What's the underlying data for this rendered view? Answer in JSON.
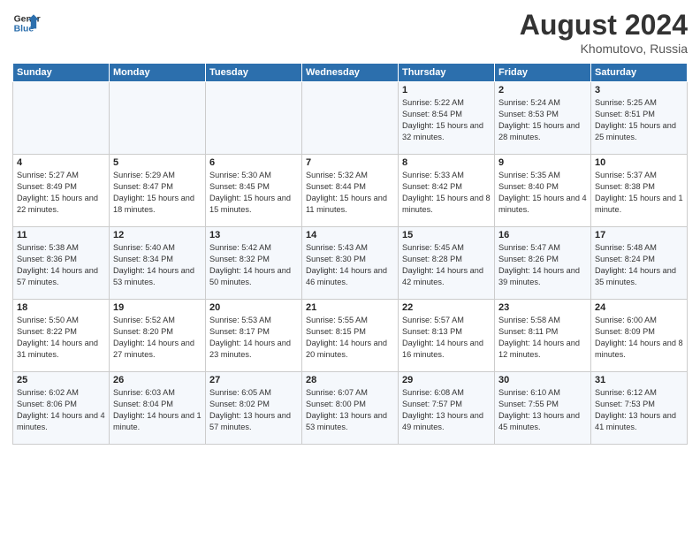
{
  "header": {
    "logo_line1": "General",
    "logo_line2": "Blue",
    "month_title": "August 2024",
    "location": "Khomutovo, Russia"
  },
  "weekdays": [
    "Sunday",
    "Monday",
    "Tuesday",
    "Wednesday",
    "Thursday",
    "Friday",
    "Saturday"
  ],
  "weeks": [
    [
      {
        "day": "",
        "empty": true
      },
      {
        "day": "",
        "empty": true
      },
      {
        "day": "",
        "empty": true
      },
      {
        "day": "",
        "empty": true
      },
      {
        "day": "1",
        "sunrise": "5:22 AM",
        "sunset": "8:54 PM",
        "daylight": "15 hours and 32 minutes."
      },
      {
        "day": "2",
        "sunrise": "5:24 AM",
        "sunset": "8:53 PM",
        "daylight": "15 hours and 28 minutes."
      },
      {
        "day": "3",
        "sunrise": "5:25 AM",
        "sunset": "8:51 PM",
        "daylight": "15 hours and 25 minutes."
      }
    ],
    [
      {
        "day": "4",
        "sunrise": "5:27 AM",
        "sunset": "8:49 PM",
        "daylight": "15 hours and 22 minutes."
      },
      {
        "day": "5",
        "sunrise": "5:29 AM",
        "sunset": "8:47 PM",
        "daylight": "15 hours and 18 minutes."
      },
      {
        "day": "6",
        "sunrise": "5:30 AM",
        "sunset": "8:45 PM",
        "daylight": "15 hours and 15 minutes."
      },
      {
        "day": "7",
        "sunrise": "5:32 AM",
        "sunset": "8:44 PM",
        "daylight": "15 hours and 11 minutes."
      },
      {
        "day": "8",
        "sunrise": "5:33 AM",
        "sunset": "8:42 PM",
        "daylight": "15 hours and 8 minutes."
      },
      {
        "day": "9",
        "sunrise": "5:35 AM",
        "sunset": "8:40 PM",
        "daylight": "15 hours and 4 minutes."
      },
      {
        "day": "10",
        "sunrise": "5:37 AM",
        "sunset": "8:38 PM",
        "daylight": "15 hours and 1 minute."
      }
    ],
    [
      {
        "day": "11",
        "sunrise": "5:38 AM",
        "sunset": "8:36 PM",
        "daylight": "14 hours and 57 minutes."
      },
      {
        "day": "12",
        "sunrise": "5:40 AM",
        "sunset": "8:34 PM",
        "daylight": "14 hours and 53 minutes."
      },
      {
        "day": "13",
        "sunrise": "5:42 AM",
        "sunset": "8:32 PM",
        "daylight": "14 hours and 50 minutes."
      },
      {
        "day": "14",
        "sunrise": "5:43 AM",
        "sunset": "8:30 PM",
        "daylight": "14 hours and 46 minutes."
      },
      {
        "day": "15",
        "sunrise": "5:45 AM",
        "sunset": "8:28 PM",
        "daylight": "14 hours and 42 minutes."
      },
      {
        "day": "16",
        "sunrise": "5:47 AM",
        "sunset": "8:26 PM",
        "daylight": "14 hours and 39 minutes."
      },
      {
        "day": "17",
        "sunrise": "5:48 AM",
        "sunset": "8:24 PM",
        "daylight": "14 hours and 35 minutes."
      }
    ],
    [
      {
        "day": "18",
        "sunrise": "5:50 AM",
        "sunset": "8:22 PM",
        "daylight": "14 hours and 31 minutes."
      },
      {
        "day": "19",
        "sunrise": "5:52 AM",
        "sunset": "8:20 PM",
        "daylight": "14 hours and 27 minutes."
      },
      {
        "day": "20",
        "sunrise": "5:53 AM",
        "sunset": "8:17 PM",
        "daylight": "14 hours and 23 minutes."
      },
      {
        "day": "21",
        "sunrise": "5:55 AM",
        "sunset": "8:15 PM",
        "daylight": "14 hours and 20 minutes."
      },
      {
        "day": "22",
        "sunrise": "5:57 AM",
        "sunset": "8:13 PM",
        "daylight": "14 hours and 16 minutes."
      },
      {
        "day": "23",
        "sunrise": "5:58 AM",
        "sunset": "8:11 PM",
        "daylight": "14 hours and 12 minutes."
      },
      {
        "day": "24",
        "sunrise": "6:00 AM",
        "sunset": "8:09 PM",
        "daylight": "14 hours and 8 minutes."
      }
    ],
    [
      {
        "day": "25",
        "sunrise": "6:02 AM",
        "sunset": "8:06 PM",
        "daylight": "14 hours and 4 minutes."
      },
      {
        "day": "26",
        "sunrise": "6:03 AM",
        "sunset": "8:04 PM",
        "daylight": "14 hours and 1 minute."
      },
      {
        "day": "27",
        "sunrise": "6:05 AM",
        "sunset": "8:02 PM",
        "daylight": "13 hours and 57 minutes."
      },
      {
        "day": "28",
        "sunrise": "6:07 AM",
        "sunset": "8:00 PM",
        "daylight": "13 hours and 53 minutes."
      },
      {
        "day": "29",
        "sunrise": "6:08 AM",
        "sunset": "7:57 PM",
        "daylight": "13 hours and 49 minutes."
      },
      {
        "day": "30",
        "sunrise": "6:10 AM",
        "sunset": "7:55 PM",
        "daylight": "13 hours and 45 minutes."
      },
      {
        "day": "31",
        "sunrise": "6:12 AM",
        "sunset": "7:53 PM",
        "daylight": "13 hours and 41 minutes."
      }
    ]
  ]
}
